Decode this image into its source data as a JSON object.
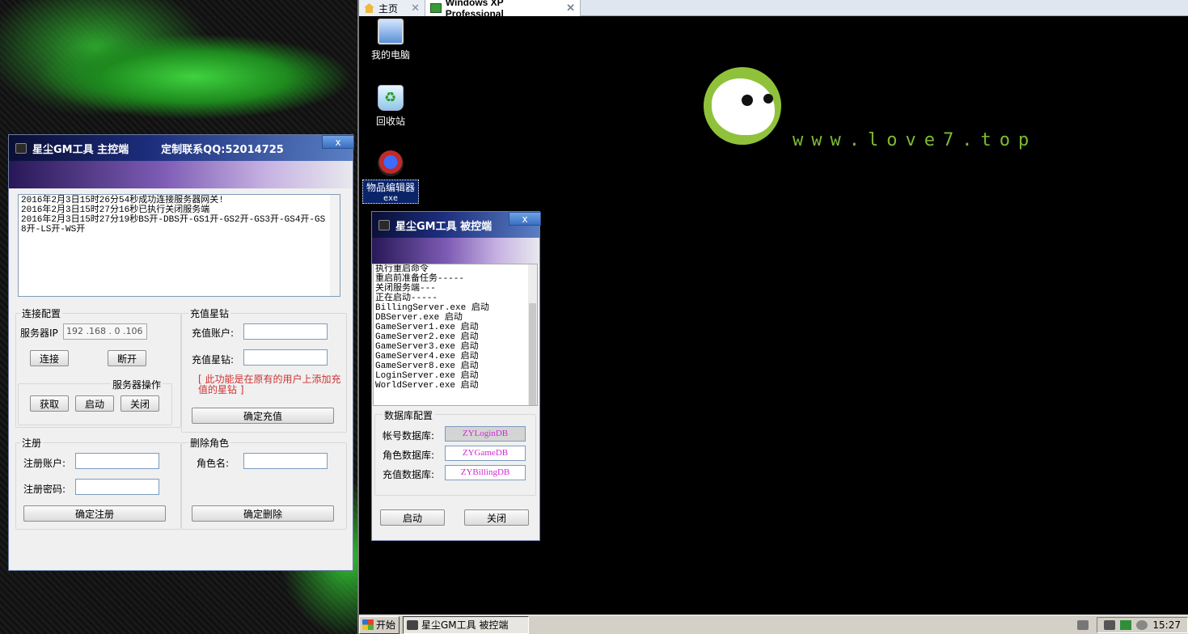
{
  "vm_tabs": [
    {
      "label": "主页",
      "active": false
    },
    {
      "label": "Windows XP Professional",
      "active": true
    }
  ],
  "desktop": {
    "icons": [
      {
        "label": "我的电脑",
        "icon": "my-computer-icon"
      },
      {
        "label": "回收站",
        "icon": "recycle-bin-icon"
      },
      {
        "label": "物品编辑器",
        "sublabel": "exe",
        "icon": "item-editor-icon",
        "selected": true
      }
    ],
    "logo_text": "www.love7.top"
  },
  "main_window": {
    "title": "星尘GM工具  主控端",
    "contact": "定制联系QQ:52014725",
    "close_label": "x",
    "log_lines": [
      "2016年2月3日15时26分54秒成功连接服务器网关!",
      "2016年2月3日15时27分16秒已执行关闭服务端",
      "2016年2月3日15时27分19秒BS开-DBS开-GS1开-GS2开-GS3开-GS4开-GS8开-LS开-WS开"
    ],
    "connect_group": {
      "title": "连接配置",
      "ip_label": "服务器IP",
      "ip_value": "192 .168 . 0  .106",
      "connect_button": "连接",
      "disconnect_button": "断开"
    },
    "server_ops": {
      "title": "服务器操作",
      "fetch_button": "获取",
      "start_button": "启动",
      "close_button": "关闭"
    },
    "recharge_group": {
      "title": "充值星钻",
      "account_label": "充值账户:",
      "amount_label": "充值星钻:",
      "warning": "[ 此功能是在原有的用户上添加充值的星钻 ]",
      "confirm_button": "确定充值"
    },
    "register_group": {
      "title": "注册",
      "account_label": "注册账户:",
      "password_label": "注册密码:",
      "confirm_button": "确定注册"
    },
    "delete_group": {
      "title": "删除角色",
      "name_label": "角色名:",
      "confirm_button": "确定删除"
    }
  },
  "client_window": {
    "title": "星尘GM工具  被控端",
    "close_label": "x",
    "log_lines": [
      "执行重启命令",
      "重启前准备任务-----",
      "关闭服务端---",
      "正在启动-----",
      "BillingServer.exe 启动",
      "DBServer.exe 启动",
      "GameServer1.exe 启动",
      "GameServer2.exe 启动",
      "GameServer3.exe 启动",
      "GameServer4.exe 启动",
      "GameServer8.exe 启动",
      "LoginServer.exe 启动",
      "WorldServer.exe 启动"
    ],
    "db_group": {
      "title": "数据库配置",
      "account_db_label": "帐号数据库:",
      "account_db_value": "ZYLoginDB",
      "role_db_label": "角色数据库:",
      "role_db_value": "ZYGameDB",
      "recharge_db_label": "充值数据库:",
      "recharge_db_value": "ZYBillingDB"
    },
    "start_button": "启动",
    "close_button": "关闭"
  },
  "taskbar": {
    "start_label": "开始",
    "task_label": "星尘GM工具  被控端",
    "clock": "15:27"
  },
  "colors": {
    "db_text": "#d02ad0",
    "warning_text": "#cc3333",
    "logo_green": "#8fc23a"
  }
}
